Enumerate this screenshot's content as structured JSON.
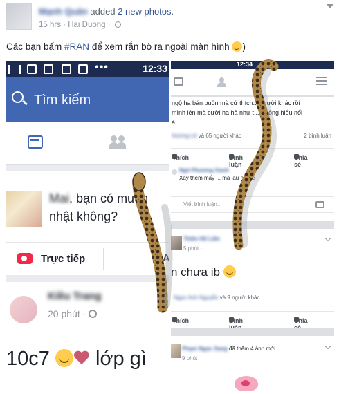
{
  "post": {
    "author_name": "Mạnh Quân",
    "action_prefix": "added",
    "action_link": "2 new photos",
    "action_suffix": ".",
    "time": "15 hrs",
    "location_sep": "·",
    "location": "Hai Duong",
    "meta_sep": "·",
    "text_before": "Các bạn bấm ",
    "hashtag": "#RAN",
    "text_after": " để xem rắn bò ra ngoài màn hình ",
    "text_end": ")"
  },
  "left_photo": {
    "status_time": "12:33",
    "status_dots": "•••",
    "search_placeholder": "Tìm kiếm",
    "composer_name": "Mai",
    "composer_text": ", bạn có muốn",
    "composer_text2": "nhật không?",
    "live_label": "Trực tiếp",
    "post_author": "Kiều Trang",
    "post_time": "20 phút",
    "post_time_sep": "·",
    "post_body": "10c7",
    "post_body_end": "lớp gì ",
    "edge_letter": "A"
  },
  "right_photo": {
    "status_time": "12:34",
    "text_line1": "ngộ ha bán buôn mà cứ thích... người khác rồi",
    "text_line2": "mình lên mà cười ha hả như t... Không hiểu nổi",
    "text_line3": "á ....",
    "likes_names": "Hương Lê",
    "likes_count": "và 65 người khác",
    "comments_count": "2 bình luận",
    "like_label": "Thích",
    "comment_label": "Bình luận",
    "share_label": "Chia sẻ",
    "reply_name": "Ngô Phương Oanh",
    "reply_text": "Xây thêm mấy ... mà lâu nữa e",
    "comment_placeholder": "Viết bình luận...",
    "post2_author": "Thiên Hồ Liên",
    "post2_time": "5 phút ·",
    "post2_body": "n chưa ib",
    "likes2_names": "Ngọc Anh Nguyễn",
    "likes2_count": "và 9 người khác",
    "post3_author": "Phạm Ngọc Sang",
    "post3_action": " đã thêm 4 ảnh mới.",
    "post3_time": "9 phút"
  }
}
